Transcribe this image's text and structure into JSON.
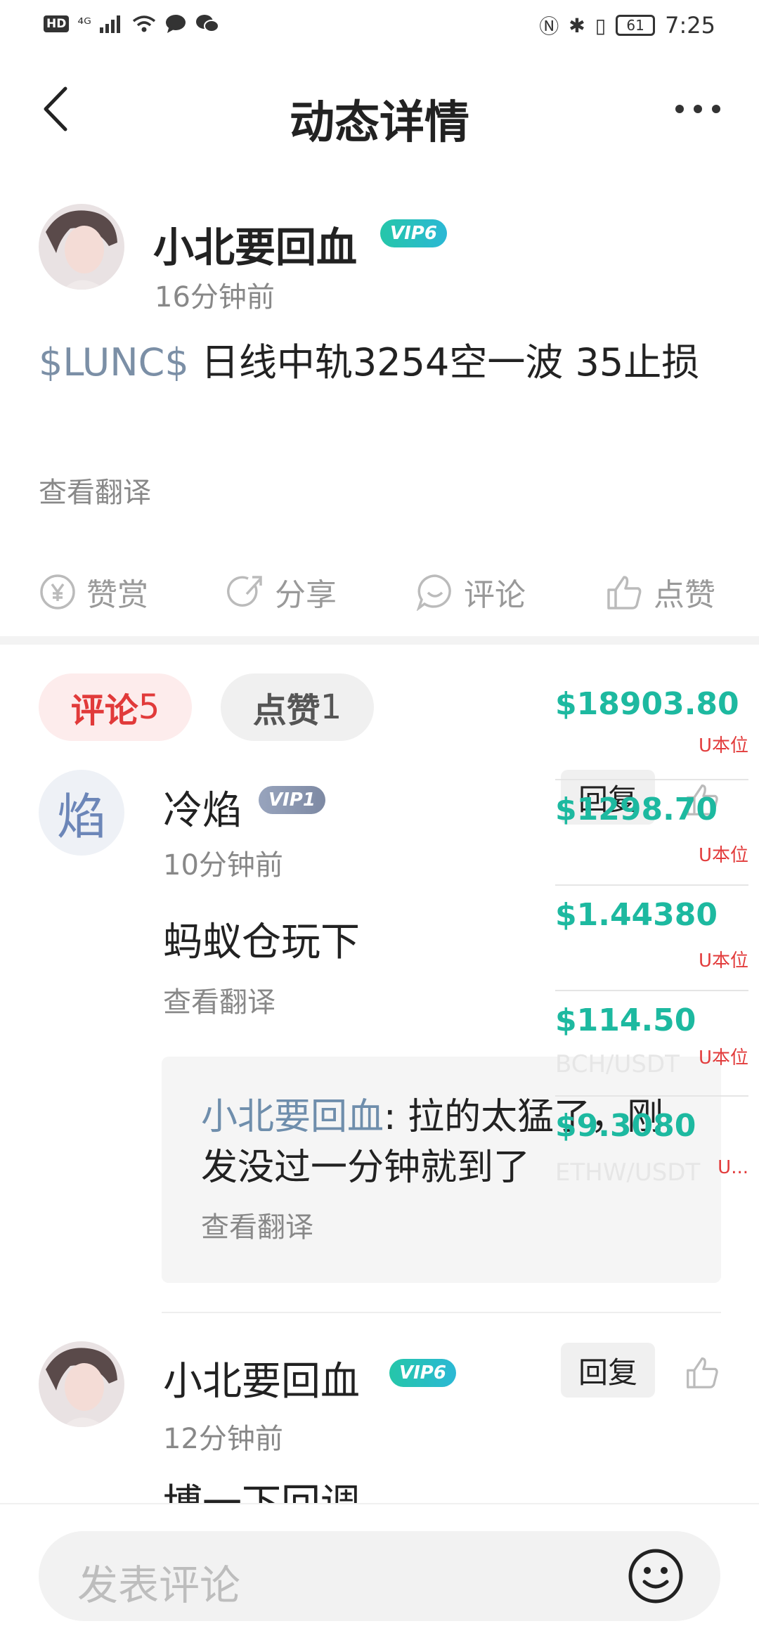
{
  "status_bar": {
    "hd": "HD",
    "network": "⁴ᴳ",
    "battery": "61",
    "time": "7:25"
  },
  "header": {
    "title": "动态详情"
  },
  "post": {
    "author": "小北要回血",
    "vip": "VIP6",
    "time": "16分钟前",
    "tag": "$LUNC$",
    "text": " 日线中轨3254空一波 35止损",
    "translate": "查看翻译"
  },
  "actions": [
    {
      "label": "赞赏",
      "icon": "yen-circle-icon"
    },
    {
      "label": "分享",
      "icon": "share-icon"
    },
    {
      "label": "评论",
      "icon": "comment-icon"
    },
    {
      "label": "点赞",
      "icon": "thumbs-up-icon"
    }
  ],
  "tabs": {
    "comments_label": "评论",
    "comments_count": "5",
    "likes_label": "点赞",
    "likes_count": "1"
  },
  "comments": [
    {
      "avatar_glyph": "焰",
      "name": "冷焰",
      "vip": "VIP1",
      "time": "10分钟前",
      "text": "蚂蚁仓玩下",
      "translate": "查看翻译",
      "reply_label": "回复",
      "reply": {
        "author": "小北要回血",
        "separator": ": ",
        "text": "拉的太猛了，刚发没过一分钟就到了",
        "translate": "查看翻译"
      }
    },
    {
      "name": "小北要回血",
      "vip": "VIP6",
      "time": "12分钟前",
      "reply_label": "回复",
      "text_clipped": "博一下回调"
    }
  ],
  "bottom": {
    "placeholder": "发表评论"
  },
  "ticker": [
    {
      "price": "$18903.80",
      "sub": "U本位",
      "pair": ""
    },
    {
      "price": "$1298.70",
      "sub": "U本位",
      "pair": ""
    },
    {
      "price": "$1.44380",
      "sub": "U本位",
      "pair": ""
    },
    {
      "price": "$114.50",
      "sub": "U本位",
      "pair": "BCH/USDT"
    },
    {
      "price": "$9.3080",
      "sub": "U...",
      "pair": "ETHW/USDT"
    }
  ],
  "colors": {
    "accent": "#1db9a0",
    "danger": "#e13a3a",
    "link": "#7b8fa6"
  }
}
